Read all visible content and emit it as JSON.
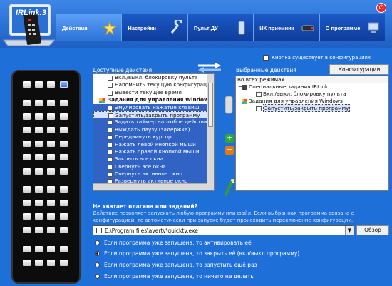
{
  "app": {
    "logo_text": "IRLink",
    "logo_version": "3"
  },
  "tabs": [
    {
      "label": "Действия",
      "icon": "actions-icon",
      "active": true
    },
    {
      "label": "Настройки",
      "icon": "settings-icon",
      "active": false
    },
    {
      "label": "Пульт ДУ",
      "icon": "remote-icon",
      "active": false
    },
    {
      "label": "ИК приемник",
      "icon": "receiver-icon",
      "active": false
    },
    {
      "label": "О программе",
      "icon": "about-icon",
      "active": false
    }
  ],
  "checkbox_config": {
    "label": "Кнопка существует в конфигурациях",
    "checked": false
  },
  "available": {
    "label": "Доступные действия",
    "items": [
      {
        "text": "Вкл./выкл. блокировку пульта",
        "type": "item"
      },
      {
        "text": "Напомнить текущую конфигураци",
        "type": "item"
      },
      {
        "text": "Вывести текущее время",
        "type": "item"
      },
      {
        "text": "Задания для управления Windows",
        "type": "group"
      },
      {
        "text": "Эмулировать нажатие клавиш",
        "type": "selected"
      },
      {
        "text": "Запустить/закрыть программу",
        "type": "selected-light"
      },
      {
        "text": "Задать таймер на любое действи",
        "type": "selected"
      },
      {
        "text": "Выждать паузу (задержка)",
        "type": "selected"
      },
      {
        "text": "Передвинуть курсор",
        "type": "selected"
      },
      {
        "text": "Нажать левой кнопкой мыши",
        "type": "selected"
      },
      {
        "text": "Нажать правой кнопкой мыши",
        "type": "selected"
      },
      {
        "text": "Закрыть все окна",
        "type": "selected"
      },
      {
        "text": "Свернуть все окна",
        "type": "selected"
      },
      {
        "text": "Свернуть активное окно",
        "type": "selected"
      },
      {
        "text": "Развернуть активное окно",
        "type": "selected"
      }
    ]
  },
  "selected": {
    "label": "Выбранные действия",
    "config_button": "Конфигурации",
    "header": "Во всех режимах",
    "tree": [
      {
        "text": "Специальные задания IRLink",
        "level": 1,
        "type": "folder"
      },
      {
        "text": "Вкл./выкл. блокировку пульта",
        "level": 2,
        "type": "item"
      },
      {
        "text": "Задания для управления Windows",
        "level": 1,
        "type": "group"
      },
      {
        "text": "Запустить/закрыть программу",
        "level": 2,
        "type": "selected"
      }
    ]
  },
  "help_link": "Не хватает плагина или заданий?",
  "description": "Действие позволяет запускать любую программу или файл. Если выбранная программа связана с конфигурацией, то автоматически при запуске будет происходить переключение конфигурации.",
  "path": {
    "value": "E:\\Program files\\avertv\\quicktv.exe",
    "browse_label": "Обзор"
  },
  "radio_options": [
    {
      "label": "Если программа уже запущена, то активировать её",
      "checked": false
    },
    {
      "label": "Если программа уже запущена, то закрыть её (вкл/выкл программу)",
      "checked": true
    },
    {
      "label": "Если программа уже запущена, то запустить ещё раз",
      "checked": false
    },
    {
      "label": "Если программа уже запущена, то ничего не делать",
      "checked": false
    }
  ],
  "colors": {
    "background": "#1f6fd8",
    "selection": "#3163c5",
    "close": "#e22222"
  }
}
